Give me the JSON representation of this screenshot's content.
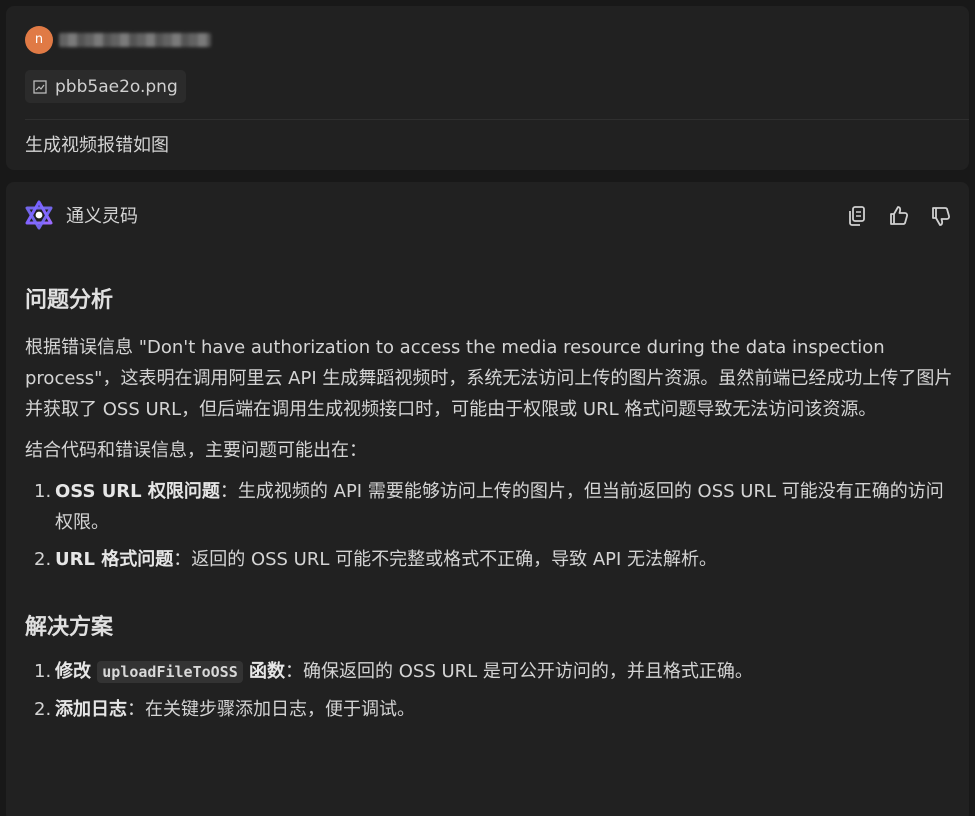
{
  "user": {
    "avatar_letter": "n",
    "attachment_name": "pbb5ae2o.png",
    "message": "生成视频报错如图"
  },
  "assistant": {
    "name": "通义灵码",
    "heading_analysis": "问题分析",
    "para1": "根据错误信息 \"Don't have authorization to access the media resource during the data inspection process\"，这表明在调用阿里云 API 生成舞蹈视频时，系统无法访问上传的图片资源。虽然前端已经成功上传了图片并获取了 OSS URL，但后端在调用生成视频接口时，可能由于权限或 URL 格式问题导致无法访问该资源。",
    "para2": "结合代码和错误信息，主要问题可能出在：",
    "issues": [
      {
        "num": "1.",
        "title": "OSS URL 权限问题",
        "text": "：生成视频的 API 需要能够访问上传的图片，但当前返回的 OSS URL 可能没有正确的访问权限。"
      },
      {
        "num": "2.",
        "title": "URL 格式问题",
        "text": "：返回的 OSS URL 可能不完整或格式不正确，导致 API 无法解析。"
      }
    ],
    "heading_solution": "解决方案",
    "solutions": [
      {
        "num": "1.",
        "title_pre": "修改 ",
        "code": "uploadFileToOSS",
        "title_post": " 函数",
        "text": "：确保返回的 OSS URL 是可公开访问的，并且格式正确。"
      },
      {
        "num": "2.",
        "title": "添加日志",
        "text": "：在关键步骤添加日志，便于调试。"
      }
    ]
  },
  "icons": {
    "attachment": "image-file-icon",
    "logo": "tongyi-lingma-logo",
    "copy": "copy-icon",
    "like": "thumbs-up-icon",
    "dislike": "thumbs-down-icon"
  },
  "colors": {
    "background": "#181818",
    "card": "#212121",
    "avatar": "#e07a45",
    "text": "#d4d4d4",
    "code_bg": "#333333"
  }
}
